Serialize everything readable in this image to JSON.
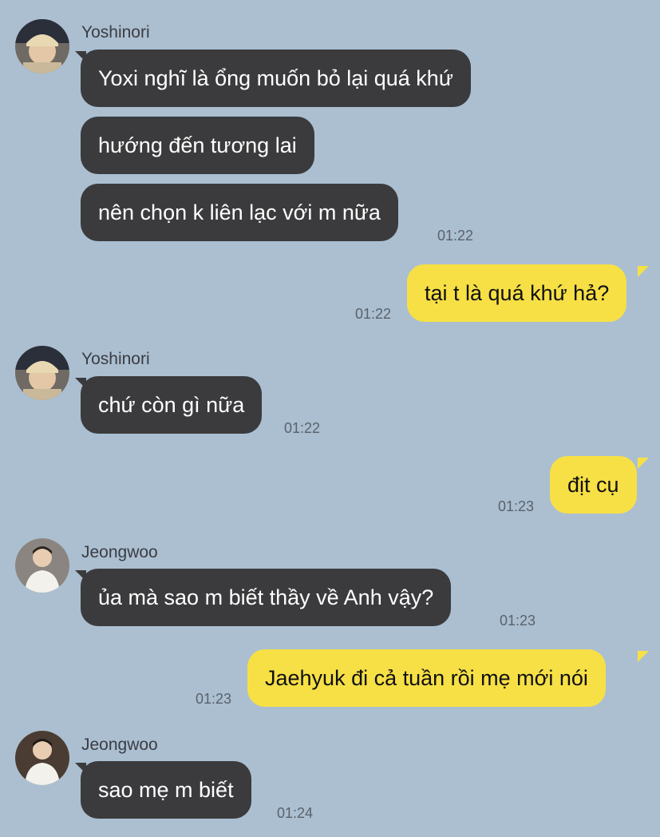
{
  "colors": {
    "background": "#abbfd1",
    "incoming_bubble": "#3b3b3d",
    "outgoing_bubble": "#f7e045"
  },
  "messages": [
    {
      "sender": "Yoshinori",
      "lines": [
        "Yoxi nghĩ là ổng muốn bỏ lại quá khứ",
        "hướng đến tương lai",
        "nên chọn k liên lạc với m nữa"
      ],
      "time": "01:22"
    },
    {
      "sender": "me",
      "text": "tại t là quá khứ hả?",
      "time": "01:22"
    },
    {
      "sender": "Yoshinori",
      "text": "chứ còn gì nữa",
      "time": "01:22"
    },
    {
      "sender": "me",
      "text": "địt cụ",
      "time": "01:23"
    },
    {
      "sender": "Jeongwoo",
      "text": "ủa mà sao m biết thầy về Anh vậy?",
      "time": "01:23"
    },
    {
      "sender": "me",
      "text": "Jaehyuk đi cả tuần rồi mẹ mới nói",
      "time": "01:23"
    },
    {
      "sender": "Jeongwoo",
      "text": "sao mẹ m biết",
      "time": "01:24"
    }
  ]
}
